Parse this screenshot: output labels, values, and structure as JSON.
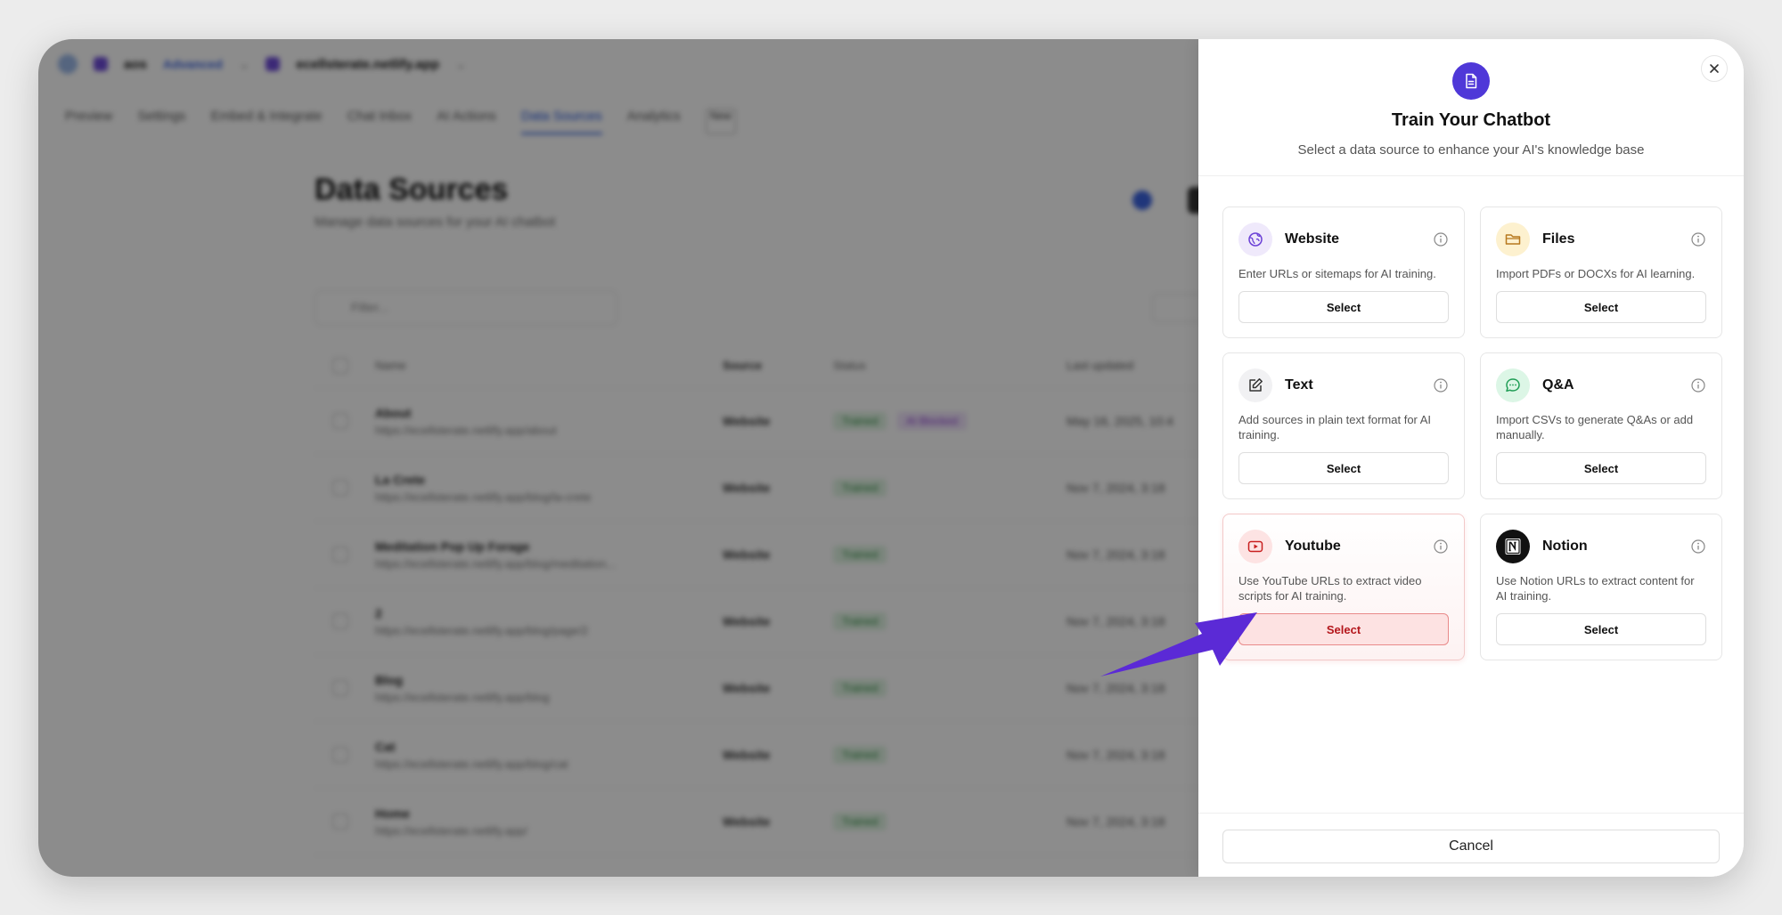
{
  "app": {
    "workspace_name": "aos",
    "workspace_badge": "Advanced",
    "site_name": "ecellsterate.netlify.app",
    "tabs": [
      {
        "label": "Preview"
      },
      {
        "label": "Settings"
      },
      {
        "label": "Embed & Integrate"
      },
      {
        "label": "Chat Inbox"
      },
      {
        "label": "AI Actions"
      },
      {
        "label": "Data Sources"
      },
      {
        "label": "Analytics"
      }
    ],
    "new_badge": "New",
    "page_title": "Data Sources",
    "page_subtitle": "Manage data sources for your AI chatbot",
    "filter_placeholder": "Filter...",
    "table": {
      "headers": {
        "name": "Name",
        "source": "Source",
        "status": "Status",
        "updated": "Last updated"
      },
      "rows": [
        {
          "name": "About",
          "url": "https://ecellsterate.netlify.app/about",
          "source": "Website",
          "status": "Trained",
          "extra": "AI Blocked",
          "date": "May 16, 2025, 10:4"
        },
        {
          "name": "La Crete",
          "url": "https://ecellsterate.netlify.app/blog/la-crete",
          "source": "Website",
          "status": "Trained",
          "extra": "",
          "date": "Nov 7, 2024, 3:18"
        },
        {
          "name": "Meditation Pop Up Forage",
          "url": "https://ecellsterate.netlify.app/blog/meditation...",
          "source": "Website",
          "status": "Trained",
          "extra": "",
          "date": "Nov 7, 2024, 3:18"
        },
        {
          "name": "2",
          "url": "https://ecellsterate.netlify.app/blog/page/2",
          "source": "Website",
          "status": "Trained",
          "extra": "",
          "date": "Nov 7, 2024, 3:18"
        },
        {
          "name": "Blog",
          "url": "https://ecellsterate.netlify.app/blog",
          "source": "Website",
          "status": "Trained",
          "extra": "",
          "date": "Nov 7, 2024, 3:18"
        },
        {
          "name": "Cat",
          "url": "https://ecellsterate.netlify.app/blog/cat",
          "source": "Website",
          "status": "Trained",
          "extra": "",
          "date": "Nov 7, 2024, 3:18"
        },
        {
          "name": "Home",
          "url": "https://ecellsterate.netlify.app/",
          "source": "Website",
          "status": "Trained",
          "extra": "",
          "date": "Nov 7, 2024, 3:18"
        }
      ]
    }
  },
  "panel": {
    "title": "Train Your Chatbot",
    "subtitle": "Select a data source to enhance your AI's knowledge base",
    "cards": [
      {
        "key": "website",
        "title": "Website",
        "description": "Enter URLs or sitemaps for AI training.",
        "button": "Select",
        "icon": "globe-icon",
        "icon_bg": "#efe9fb",
        "icon_color": "#6a3fd6"
      },
      {
        "key": "files",
        "title": "Files",
        "description": "Import PDFs or DOCXs for AI learning.",
        "button": "Select",
        "icon": "folder-icon",
        "icon_bg": "#fdf1cf",
        "icon_color": "#b7791f"
      },
      {
        "key": "text",
        "title": "Text",
        "description": "Add sources in plain text format for AI training.",
        "button": "Select",
        "icon": "pencil-icon",
        "icon_bg": "#f1f1f3",
        "icon_color": "#333333"
      },
      {
        "key": "qa",
        "title": "Q&A",
        "description": "Import CSVs to generate Q&As or add manually.",
        "button": "Select",
        "icon": "chat-bubble-icon",
        "icon_bg": "#dcf6e6",
        "icon_color": "#1f9d55"
      },
      {
        "key": "youtube",
        "title": "Youtube",
        "description": "Use YouTube URLs to extract video scripts for AI training.",
        "button": "Select",
        "icon": "youtube-icon",
        "icon_bg": "#fde3e3",
        "icon_color": "#c81e1e"
      },
      {
        "key": "notion",
        "title": "Notion",
        "description": "Use Notion URLs to extract content for AI training.",
        "button": "Select",
        "icon": "notion-icon",
        "icon_bg": "#111111",
        "icon_color": "#ffffff"
      }
    ],
    "cancel_label": "Cancel"
  },
  "colors": {
    "accent": "#4f38d8",
    "youtube_highlight": "#b4161b",
    "arrow": "#5b2ad6"
  }
}
